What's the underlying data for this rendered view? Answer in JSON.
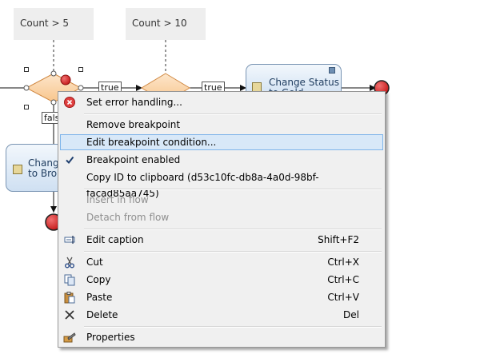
{
  "diagram": {
    "annotations": [
      {
        "text": "Count > 5"
      },
      {
        "text": "Count > 10"
      }
    ],
    "flow_labels": {
      "true_1": "true",
      "true_2": "true",
      "false_1": "fals"
    },
    "activities": {
      "change_status": {
        "line1": "Change Status",
        "line2": "to Gold"
      },
      "change_bronze": {
        "line1": "Chang",
        "line2": "to Bro"
      }
    }
  },
  "context_menu": {
    "items": [
      {
        "label": "Set error handling...",
        "icon": "error-handling-icon",
        "enabled": true
      },
      {
        "label": "Remove breakpoint",
        "enabled": true
      },
      {
        "label": "Edit breakpoint condition...",
        "enabled": true,
        "highlighted": true
      },
      {
        "label": "Breakpoint enabled",
        "icon": "checkmark-icon",
        "checked": true,
        "enabled": true
      },
      {
        "label": "Copy ID to clipboard (d53c10fc-db8a-4a0d-98bf-facad85aa745)",
        "enabled": true
      },
      {
        "label": "Insert in flow",
        "enabled": false
      },
      {
        "label": "Detach from flow",
        "enabled": false
      },
      {
        "label": "Edit caption",
        "shortcut": "Shift+F2",
        "icon": "edit-caption-icon",
        "enabled": true
      },
      {
        "label": "Cut",
        "shortcut": "Ctrl+X",
        "icon": "scissors-icon",
        "enabled": true
      },
      {
        "label": "Copy",
        "shortcut": "Ctrl+C",
        "icon": "copy-icon",
        "enabled": true
      },
      {
        "label": "Paste",
        "shortcut": "Ctrl+V",
        "icon": "paste-icon",
        "enabled": true
      },
      {
        "label": "Delete",
        "shortcut": "Del",
        "icon": "delete-x-icon",
        "enabled": true
      },
      {
        "label": "Properties",
        "icon": "properties-icon",
        "enabled": true
      }
    ]
  },
  "colors": {
    "decision_fill": "#fbd3a8",
    "decision_stroke": "#d18a45",
    "end_event": "#d42a2a",
    "activity_border": "#7a95b3",
    "menu_highlight": "#d8e8f8",
    "menu_highlight_border": "#7eb4ea"
  }
}
